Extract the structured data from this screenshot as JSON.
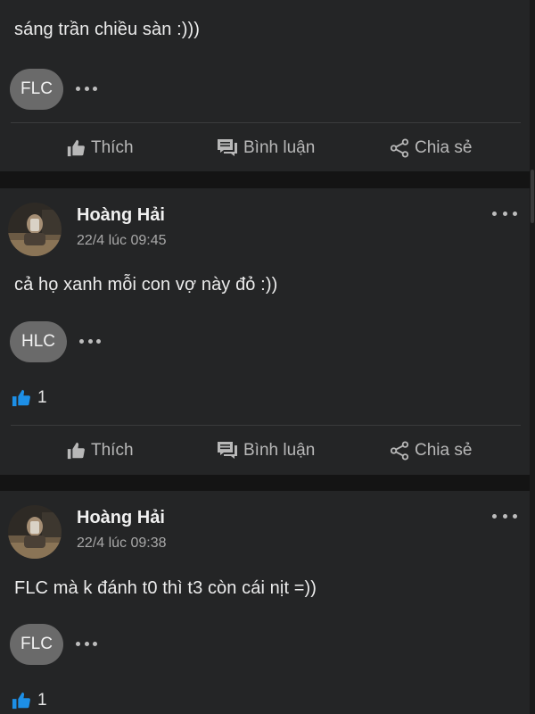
{
  "colors": {
    "page_background": "#141414",
    "card_background": "#242526",
    "tag_chip_background": "#6a6a6a",
    "like_blue": "#1d8fe6",
    "action_text": "#b8b8b8"
  },
  "posts": [
    {
      "text": "sáng trần chiều sàn :)))",
      "tag": "FLC",
      "actions": {
        "like": "Thích",
        "comment": "Bình luận",
        "share": "Chia sẻ"
      }
    },
    {
      "author": "Hoàng Hải",
      "time": "22/4 lúc 09:45",
      "text": "cả họ xanh mỗi con vợ này đỏ :))",
      "tag": "HLC",
      "like_count": "1",
      "actions": {
        "like": "Thích",
        "comment": "Bình luận",
        "share": "Chia sẻ"
      }
    },
    {
      "author": "Hoàng Hải",
      "time": "22/4 lúc 09:38",
      "text": "FLC mà k đánh t0 thì t3 còn cái nịt =))",
      "tag": "FLC",
      "like_count": "1"
    }
  ]
}
